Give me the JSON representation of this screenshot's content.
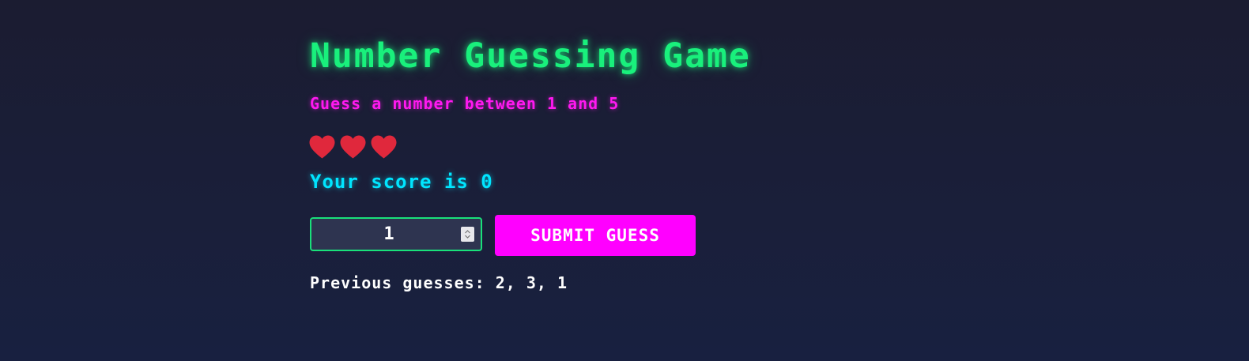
{
  "game": {
    "title": "Number Guessing Game",
    "instructions": "Guess a number between 1 and 5",
    "lives": 3,
    "lives_icons": [
      "heart-icon",
      "heart-icon",
      "heart-icon"
    ],
    "score_text": "Your score is 0",
    "guess_input": {
      "value": "1"
    },
    "submit_label": "SUBMIT GUESS",
    "previous_guesses_text": "Previous guesses: 2, 3, 1"
  },
  "colors": {
    "title": "#19f07c",
    "instructions": "#ff19f0",
    "score": "#00e5ff",
    "heart": "#e0283c",
    "button": "#ff00ff",
    "input_border": "#19e07a"
  }
}
